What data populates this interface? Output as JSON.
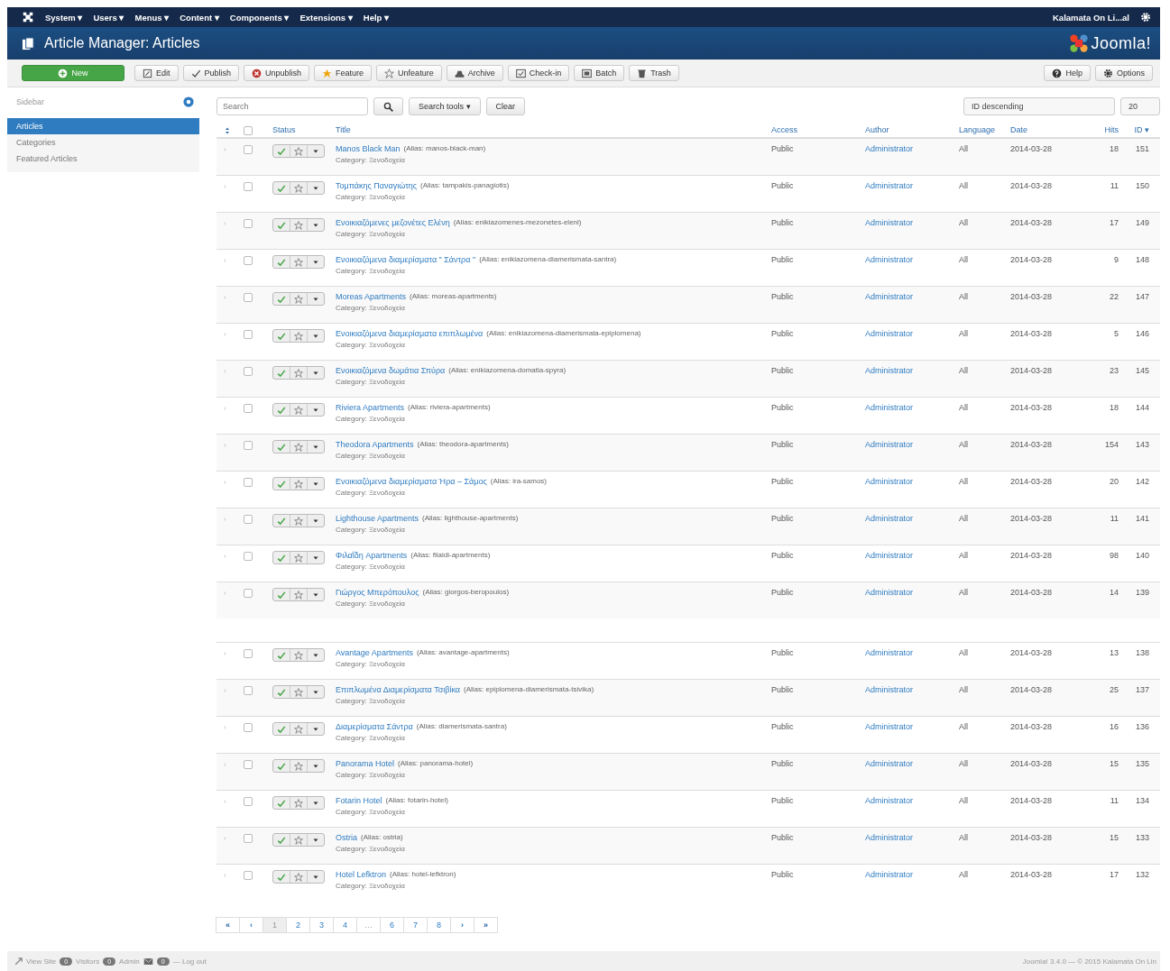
{
  "topnav": {
    "menus": [
      "System ▾",
      "Users ▾",
      "Menus ▾",
      "Content ▾",
      "Components ▾",
      "Extensions ▾",
      "Help ▾"
    ],
    "site_name": "Kalamata On Li...al"
  },
  "header": {
    "title": "Article Manager: Articles",
    "logo": "Joomla!"
  },
  "toolbar": {
    "buttons": [
      {
        "label": "New",
        "kind": "primary"
      },
      {
        "label": "Edit",
        "kind": "default"
      },
      {
        "label": "Publish",
        "kind": "default"
      },
      {
        "label": "Unpublish",
        "kind": "default"
      },
      {
        "label": "Feature",
        "kind": "default"
      },
      {
        "label": "Unfeature",
        "kind": "default"
      },
      {
        "label": "Archive",
        "kind": "default"
      },
      {
        "label": "Check-in",
        "kind": "default"
      },
      {
        "label": "Batch",
        "kind": "default"
      },
      {
        "label": "Trash",
        "kind": "default"
      }
    ],
    "right_buttons": [
      "Help",
      "Options"
    ]
  },
  "sidebar": {
    "title": "Sidebar",
    "items": [
      {
        "label": "Articles",
        "selected": true
      },
      {
        "label": "Categories",
        "selected": false
      },
      {
        "label": "Featured Articles",
        "selected": false
      }
    ]
  },
  "filters": {
    "search": {
      "placeholder": "Search"
    },
    "search_tools": "Search tools ▾",
    "clear": "Clear",
    "ordering": "ID descending",
    "limit": "20"
  },
  "table": {
    "select_all_checked": false,
    "columns": [
      "Status",
      "Title",
      "Access",
      "Author",
      "Language",
      "Date",
      "Hits",
      "ID ▾"
    ],
    "rows": [
      {
        "title": "Manos Black Man",
        "alias": "(Alias: manos-black-man)",
        "category": "Category: Ξενοδοχεία",
        "access": "Public",
        "author": "Administrator",
        "language": "All",
        "date": "2014-03-28",
        "hits": "18",
        "id": "151",
        "checked": false,
        "published": true,
        "featured": false,
        "gap_before": false
      },
      {
        "title": "Τομπάκης Παναγιώτης",
        "alias": "(Alias: tampakis-panagiotis)",
        "category": "Category: Ξενοδοχεία",
        "access": "Public",
        "author": "Administrator",
        "language": "All",
        "date": "2014-03-28",
        "hits": "11",
        "id": "150",
        "checked": false,
        "published": true,
        "featured": false,
        "gap_before": false
      },
      {
        "title": "Ενοικιαζόμενες μεζονέτες Ελένη",
        "alias": "(Alias: enikiazomenes-mezonetes-eleni)",
        "category": "Category: Ξενοδοχεία",
        "access": "Public",
        "author": "Administrator",
        "language": "All",
        "date": "2014-03-28",
        "hits": "17",
        "id": "149",
        "checked": false,
        "published": true,
        "featured": false,
        "gap_before": false
      },
      {
        "title": "Ενοικιαζόμενα διαμερίσματα \" Σάντρα \"",
        "alias": "(Alias: enikiazomena-diamerismata-santra)",
        "category": "Category: Ξενοδοχεία",
        "access": "Public",
        "author": "Administrator",
        "language": "All",
        "date": "2014-03-28",
        "hits": "9",
        "id": "148",
        "checked": false,
        "published": true,
        "featured": false,
        "gap_before": false
      },
      {
        "title": "Moreas Apartments",
        "alias": "(Alias: moreas-apartments)",
        "category": "Category: Ξενοδοχεία",
        "access": "Public",
        "author": "Administrator",
        "language": "All",
        "date": "2014-03-28",
        "hits": "22",
        "id": "147",
        "checked": false,
        "published": true,
        "featured": false,
        "gap_before": false
      },
      {
        "title": "Ενοικιαζόμενα διαμερίσματα επιπλωμένα",
        "alias": "(Alias: enikiazomena-diamerismata-epiplomena)",
        "category": "Category: Ξενοδοχεία",
        "access": "Public",
        "author": "Administrator",
        "language": "All",
        "date": "2014-03-28",
        "hits": "5",
        "id": "146",
        "checked": false,
        "published": true,
        "featured": false,
        "gap_before": false
      },
      {
        "title": "Ενοικιαζόμενα δωμάτια Σπύρα",
        "alias": "(Alias: enikiazomena-domatia-spyra)",
        "category": "Category: Ξενοδοχεία",
        "access": "Public",
        "author": "Administrator",
        "language": "All",
        "date": "2014-03-28",
        "hits": "23",
        "id": "145",
        "checked": false,
        "published": true,
        "featured": false,
        "gap_before": false
      },
      {
        "title": "Riviera Apartments",
        "alias": "(Alias: riviera-apartments)",
        "category": "Category: Ξενοδοχεία",
        "access": "Public",
        "author": "Administrator",
        "language": "All",
        "date": "2014-03-28",
        "hits": "18",
        "id": "144",
        "checked": false,
        "published": true,
        "featured": false,
        "gap_before": false
      },
      {
        "title": "Theodora Apartments",
        "alias": "(Alias: theodora-apartments)",
        "category": "Category: Ξενοδοχεία",
        "access": "Public",
        "author": "Administrator",
        "language": "All",
        "date": "2014-03-28",
        "hits": "154",
        "id": "143",
        "checked": false,
        "published": true,
        "featured": false,
        "gap_before": false
      },
      {
        "title": "Ενοικιαζόμενα διαμερίσματα Ήρα – Σάμος",
        "alias": "(Alias: ira-samos)",
        "category": "Category: Ξενοδοχεία",
        "access": "Public",
        "author": "Administrator",
        "language": "All",
        "date": "2014-03-28",
        "hits": "20",
        "id": "142",
        "checked": false,
        "published": true,
        "featured": false,
        "gap_before": false
      },
      {
        "title": "Lighthouse Apartments",
        "alias": "(Alias: lighthouse-apartments)",
        "category": "Category: Ξενοδοχεία",
        "access": "Public",
        "author": "Administrator",
        "language": "All",
        "date": "2014-03-28",
        "hits": "11",
        "id": "141",
        "checked": false,
        "published": true,
        "featured": false,
        "gap_before": false
      },
      {
        "title": "Φιλαΐδη Apartments",
        "alias": "(Alias: filaidi-apartments)",
        "category": "Category: Ξενοδοχεία",
        "access": "Public",
        "author": "Administrator",
        "language": "All",
        "date": "2014-03-28",
        "hits": "98",
        "id": "140",
        "checked": false,
        "published": true,
        "featured": false,
        "gap_before": false
      },
      {
        "title": "Γιώργος Μπερόπουλος",
        "alias": "(Alias: giorgos-beropoulos)",
        "category": "Category: Ξενοδοχεία",
        "access": "Public",
        "author": "Administrator",
        "language": "All",
        "date": "2014-03-28",
        "hits": "14",
        "id": "139",
        "checked": false,
        "published": true,
        "featured": false,
        "gap_before": false
      },
      {
        "title": "Avantage Apartments",
        "alias": "(Alias: avantage-apartments)",
        "category": "Category: Ξενοδοχεία",
        "access": "Public",
        "author": "Administrator",
        "language": "All",
        "date": "2014-03-28",
        "hits": "13",
        "id": "138",
        "checked": false,
        "published": true,
        "featured": false,
        "gap_before": true
      },
      {
        "title": "Επιπλωμένα Διαμερίσματα Τσιβίκα",
        "alias": "(Alias: epiplomena-diamerismata-tsivika)",
        "category": "Category: Ξενοδοχεία",
        "access": "Public",
        "author": "Administrator",
        "language": "All",
        "date": "2014-03-28",
        "hits": "25",
        "id": "137",
        "checked": false,
        "published": true,
        "featured": false,
        "gap_before": false
      },
      {
        "title": "Διαμερίσματα Σάντρα",
        "alias": "(Alias: diamerismata-santra)",
        "category": "Category: Ξενοδοχεία",
        "access": "Public",
        "author": "Administrator",
        "language": "All",
        "date": "2014-03-28",
        "hits": "16",
        "id": "136",
        "checked": false,
        "published": true,
        "featured": false,
        "gap_before": false
      },
      {
        "title": "Panorama Hotel",
        "alias": "(Alias: panorama-hotel)",
        "category": "Category: Ξενοδοχεία",
        "access": "Public",
        "author": "Administrator",
        "language": "All",
        "date": "2014-03-28",
        "hits": "15",
        "id": "135",
        "checked": false,
        "published": true,
        "featured": false,
        "gap_before": false
      },
      {
        "title": "Fotarin Hotel",
        "alias": "(Alias: fotarin-hotel)",
        "category": "Category: Ξενοδοχεία",
        "access": "Public",
        "author": "Administrator",
        "language": "All",
        "date": "2014-03-28",
        "hits": "11",
        "id": "134",
        "checked": false,
        "published": true,
        "featured": false,
        "gap_before": false
      },
      {
        "title": "Ostria",
        "alias": "(Alias: ostria)",
        "category": "Category: Ξενοδοχεία",
        "access": "Public",
        "author": "Administrator",
        "language": "All",
        "date": "2014-03-28",
        "hits": "15",
        "id": "133",
        "checked": false,
        "published": true,
        "featured": false,
        "gap_before": false
      },
      {
        "title": "Hotel Lefktron",
        "alias": "(Alias: hotel-lefktron)",
        "category": "Category: Ξενοδοχεία",
        "access": "Public",
        "author": "Administrator",
        "language": "All",
        "date": "2014-03-28",
        "hits": "17",
        "id": "132",
        "checked": false,
        "published": true,
        "featured": false,
        "gap_before": false
      }
    ]
  },
  "pagination": [
    {
      "label": "«",
      "kind": "first",
      "selected": false
    },
    {
      "label": "‹",
      "kind": "prev",
      "selected": false
    },
    {
      "label": "1",
      "kind": "page",
      "selected": true
    },
    {
      "label": "2",
      "kind": "page",
      "selected": false
    },
    {
      "label": "3",
      "kind": "page",
      "selected": false
    },
    {
      "label": "4",
      "kind": "page",
      "selected": false
    },
    {
      "label": "…",
      "kind": "ellipsis",
      "selected": false
    },
    {
      "label": "6",
      "kind": "page",
      "selected": false
    },
    {
      "label": "7",
      "kind": "page",
      "selected": false
    },
    {
      "label": "8",
      "kind": "page",
      "selected": false
    },
    {
      "label": "›",
      "kind": "next",
      "selected": false
    },
    {
      "label": "»",
      "kind": "last",
      "selected": false
    }
  ],
  "status_bar": {
    "view_site": "View Site",
    "visitors_count": "0",
    "visitors": "Visitors",
    "admin_count": "0",
    "admin": "Admin",
    "messages_count": "0",
    "logout": "— Log out",
    "copyright": "Joomla! 3.4.0 — © 2015 Kalamata On Lin"
  }
}
